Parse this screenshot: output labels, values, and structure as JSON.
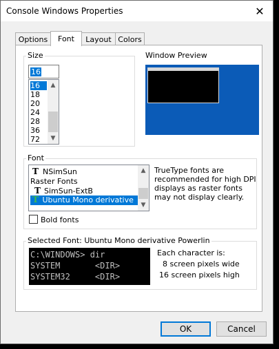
{
  "window": {
    "title": "Console Windows Properties"
  },
  "tabs": [
    {
      "label": "Options"
    },
    {
      "label": "Font"
    },
    {
      "label": "Layout"
    },
    {
      "label": "Colors"
    }
  ],
  "size_group": {
    "label": "Size",
    "input_value": "16",
    "items": [
      "16",
      "18",
      "20",
      "24",
      "28",
      "36",
      "72"
    ],
    "selected": "16"
  },
  "preview": {
    "label": "Window Preview"
  },
  "font_group": {
    "label": "Font",
    "items": [
      {
        "label": "NSimSun",
        "icon": "truetype-icon"
      },
      {
        "label": "Raster Fonts",
        "icon": "none"
      },
      {
        "label": "SimSun-ExtB",
        "icon": "truetype-icon"
      },
      {
        "label": "Ubuntu Mono derivative Powerlin",
        "icon": "truetype-color-icon"
      }
    ],
    "note": "TrueType fonts are recommended for high DPI displays as raster fonts may not display clearly.",
    "bold_label": "Bold fonts",
    "bold_checked": false
  },
  "selected_font": {
    "label": "Selected Font: Ubuntu Mono derivative Powerlin",
    "console_lines": [
      "C:\\WINDOWS> dir",
      "SYSTEM       <DIR>",
      "SYSTEM32     <DIR>"
    ],
    "char_heading": "Each character is:",
    "char_width": "8 screen pixels wide",
    "char_height": "16 screen pixels high"
  },
  "buttons": {
    "ok": "OK",
    "cancel": "Cancel"
  },
  "colors": {
    "accent": "#0078d7",
    "preview_bg": "#0b5bb7"
  }
}
